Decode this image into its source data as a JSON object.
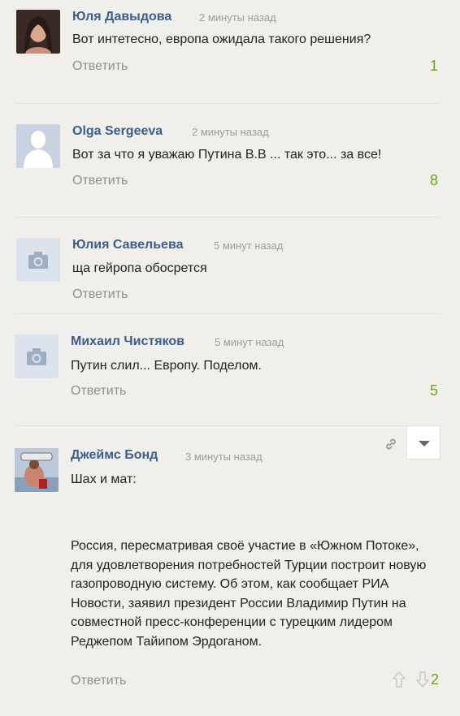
{
  "reply_label": "Ответить",
  "comments": [
    {
      "author": "Юля Давыдова",
      "time": "2 минуты назад",
      "text": "Вот интетесно, европа ожидала такого решения?",
      "score": "1"
    },
    {
      "author": "Olga Sergeeva",
      "time": "2 минуты назад",
      "text": "Вот за что я уважаю Путина В.В ... так это... за все!",
      "score": "8"
    },
    {
      "author": "Юлия Савельева",
      "time": "5 минут назад",
      "text": "ща гейропа обосрется",
      "score": ""
    },
    {
      "author": "Михаил Чистяков",
      "time": "5 минут назад",
      "text": "Путин слил... Европу. Поделом.",
      "score": "5"
    },
    {
      "author": "Джеймс Бонд",
      "time": "3 минуты назад",
      "text": "Шах и мат:",
      "article": "Россия, пересматривая своё участие в «Южном Потоке», для удовлетворения потребностей Турции построит новую газопроводную систему. Об этом, как сообщает РИА Новости, заявил президент России Владимир Путин на совместной пресс-конференции с турецким лидером Реджепом Тайипом Эрдоганом.",
      "score": "2"
    }
  ],
  "colors": {
    "author": "#3b5e8f",
    "score": "#6aa51c",
    "background": "#f0efeb"
  },
  "icons": {
    "link": "link-icon",
    "menu": "chevron-down-icon",
    "upvote": "arrow-up-icon",
    "downvote": "arrow-down-icon",
    "placeholder": "camera-icon",
    "silhouette": "user-silhouette-icon"
  }
}
